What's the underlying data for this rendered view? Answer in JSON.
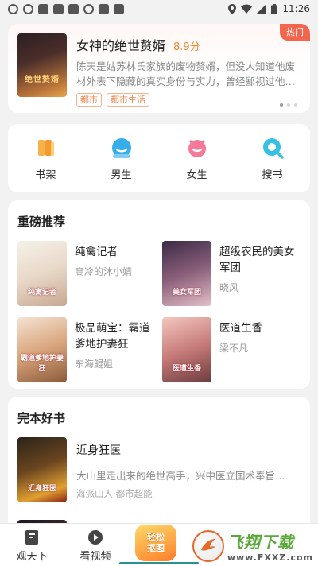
{
  "status_bar": {
    "time": "11:26"
  },
  "featured": {
    "badge": "热门",
    "title": "女神的绝世赘婿",
    "score": "8.9分",
    "description": "陈天是姑苏林氏家族的废物赘婿，但没人知道他废材外表下隐藏的真实身份与实力，曾经鄙视过他…",
    "tags": [
      "都市",
      "都市生活"
    ],
    "cover_text": "绝世赘婿"
  },
  "quick_nav": [
    {
      "label": "书架",
      "icon": "bookshelf-icon",
      "color": "#f5a53a"
    },
    {
      "label": "男生",
      "icon": "male-icon",
      "color": "#2fa8e8"
    },
    {
      "label": "女生",
      "icon": "female-icon",
      "color": "#f2668b"
    },
    {
      "label": "搜书",
      "icon": "search-icon",
      "color": "#2fbde0"
    }
  ],
  "recommend": {
    "title": "重磅推荐",
    "books": [
      {
        "title": "纯禽记者",
        "author": "高冷的沐小婧",
        "cover_text": "纯禽记者"
      },
      {
        "title": "超级农民的美女军团",
        "author": "晓风",
        "cover_text": "美女军团"
      },
      {
        "title": "极品萌宝：霸道爹地护妻狂",
        "author": "东海鲲姐",
        "cover_text": "霸道爹地护妻狂"
      },
      {
        "title": "医道生香",
        "author": "梁不凡",
        "cover_text": "医道生香"
      }
    ]
  },
  "completed": {
    "title": "完本好书",
    "books": [
      {
        "title": "近身狂医",
        "description": "大山里走出来的绝世高手，兴中医立国术奉旨…",
        "meta": "海派山人·都市超能",
        "cover_text": "近身狂医"
      }
    ]
  },
  "bottom_nav": [
    {
      "label": "观天下",
      "icon": "book-icon"
    },
    {
      "label": "看视频",
      "icon": "play-icon"
    }
  ],
  "promo": {
    "line1": "轻松",
    "line2": "抠图"
  },
  "watermark": {
    "name": "飞翔下载",
    "domain": "www.FXXZ.com"
  }
}
